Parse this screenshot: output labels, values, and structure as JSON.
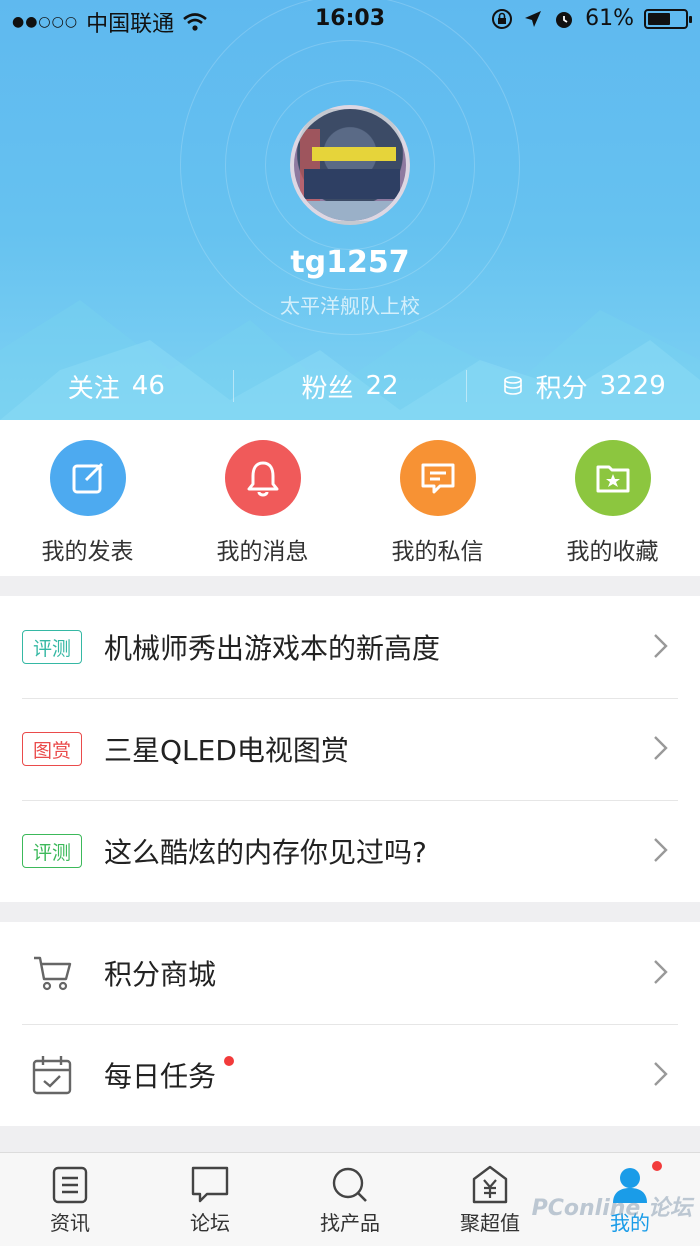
{
  "status_bar": {
    "signal_dots": "●●○○○",
    "carrier": "中国联通",
    "time": "16:03",
    "battery_text": "61%",
    "battery_level": 0.61
  },
  "profile": {
    "username": "tg1257",
    "rank": "太平洋舰队上校",
    "stats": [
      {
        "label": "关注",
        "value": "46"
      },
      {
        "label": "粉丝",
        "value": "22"
      },
      {
        "label": "积分",
        "value": "3229",
        "icon": "coins-icon"
      }
    ]
  },
  "quick_actions": [
    {
      "label": "我的发表",
      "icon": "edit-icon",
      "color": "#4daaf0"
    },
    {
      "label": "我的消息",
      "icon": "bell-icon",
      "color": "#f05a5a"
    },
    {
      "label": "我的私信",
      "icon": "message-icon",
      "color": "#f79234"
    },
    {
      "label": "我的收藏",
      "icon": "star-folder-icon",
      "color": "#8cc63f"
    }
  ],
  "recommendations": [
    {
      "tag": "评测",
      "tag_color": "#35b8a4",
      "title": "机械师秀出游戏本的新高度"
    },
    {
      "tag": "图赏",
      "tag_color": "#ea4b4b",
      "title": "三星QLED电视图赏"
    },
    {
      "tag": "评测",
      "tag_color": "#3cb95a",
      "title": "这么酷炫的内存你见过吗?"
    }
  ],
  "menu": [
    {
      "label": "积分商城",
      "icon": "cart-icon",
      "has_dot": false
    },
    {
      "label": "每日任务",
      "icon": "calendar-check-icon",
      "has_dot": true
    }
  ],
  "tabs": [
    {
      "label": "资讯",
      "icon": "news-icon",
      "active": false
    },
    {
      "label": "论坛",
      "icon": "forum-icon",
      "active": false
    },
    {
      "label": "找产品",
      "icon": "search-icon",
      "active": false
    },
    {
      "label": "聚超值",
      "icon": "yen-tag-icon",
      "active": false
    },
    {
      "label": "我的",
      "icon": "user-icon",
      "active": true
    }
  ],
  "watermark": "PConline 论坛",
  "colors": {
    "accent": "#1a9ce8",
    "header": "#66c2f0",
    "badge": "#f23b3b"
  }
}
